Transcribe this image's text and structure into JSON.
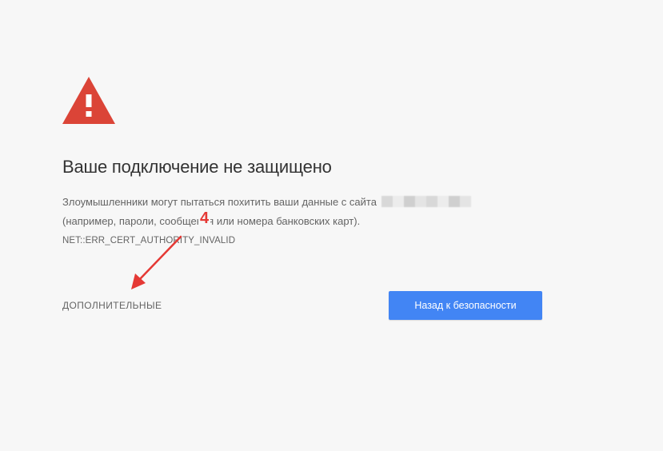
{
  "warning": {
    "icon": "warning-triangle-icon",
    "color": "#db4437"
  },
  "title": "Ваше подключение не защищено",
  "description": {
    "line1": "Злоумышленники могут пытаться похитить ваши данные с сайта",
    "line2": "(например, пароли, сообщения или номера банковских карт)."
  },
  "error_code": "NET::ERR_CERT_AUTHORITY_INVALID",
  "details_label": "ДОПОЛНИТЕЛЬНЫЕ",
  "back_button_label": "Назад к безопасности",
  "annotation": {
    "number": "4",
    "color": "#e53935"
  },
  "colors": {
    "background": "#f7f7f7",
    "button": "#4285f4",
    "button_text": "#ffffff"
  }
}
